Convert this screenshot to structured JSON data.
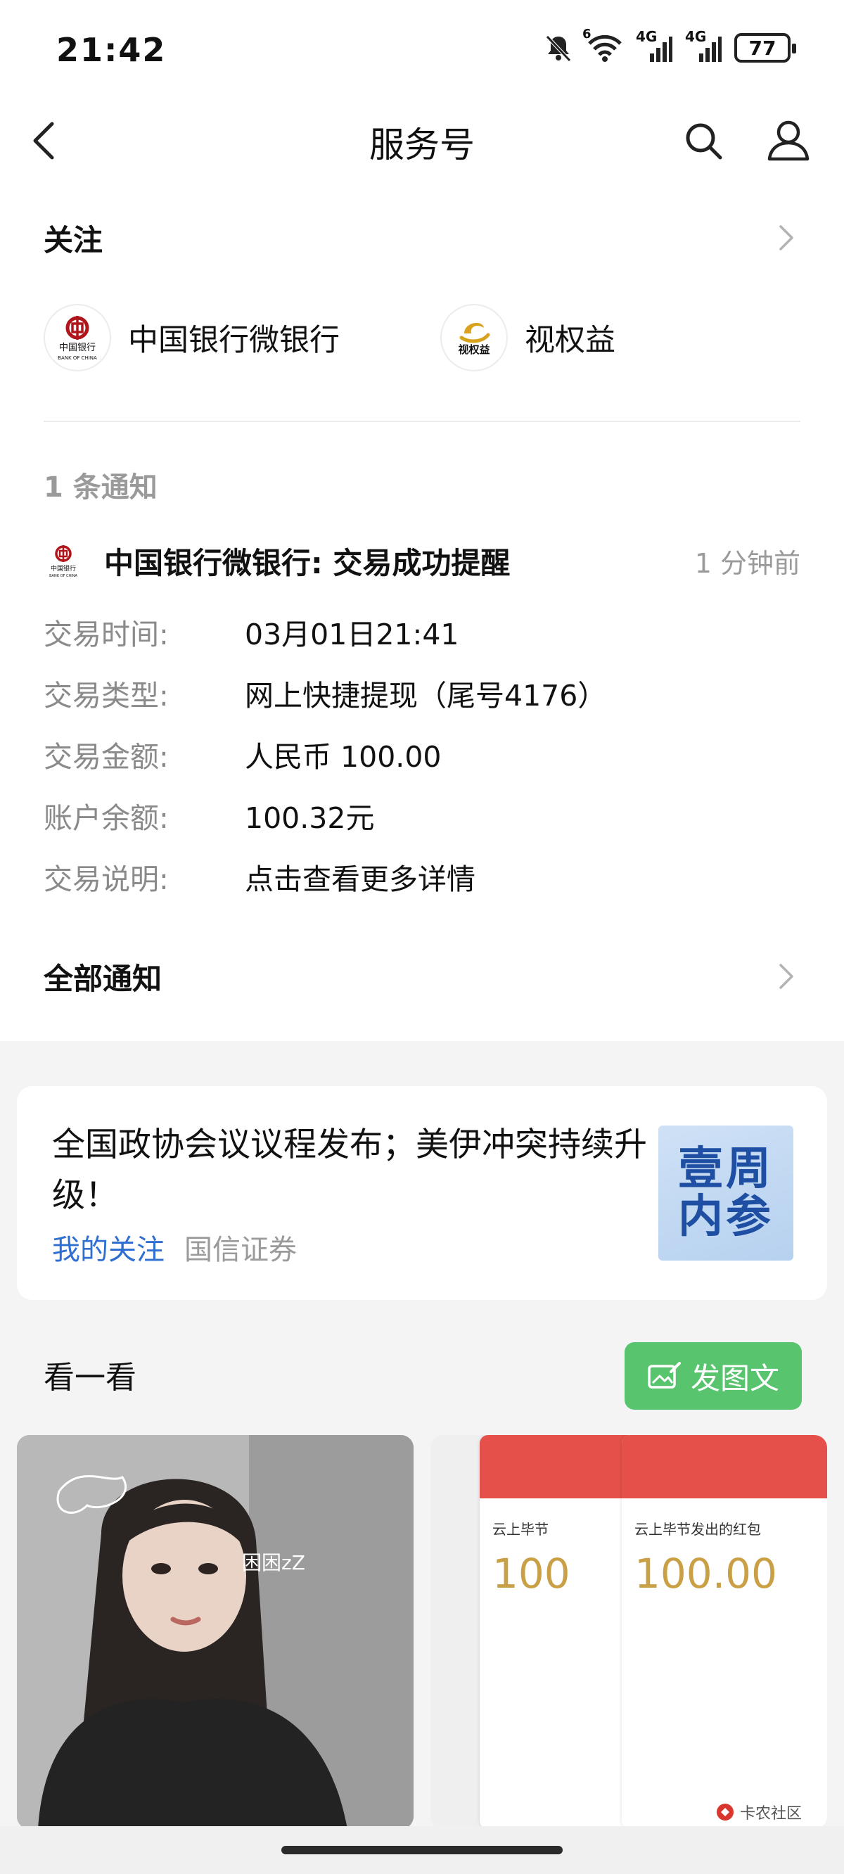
{
  "status_bar": {
    "time": "21:42",
    "icons": [
      "bell-off-icon",
      "wifi-icon",
      "signal-4g-icon",
      "signal-4g-icon"
    ],
    "wifi_label": "6",
    "signal1_label": "4G",
    "signal2_label": "4G",
    "battery": "77"
  },
  "nav": {
    "title": "服务号"
  },
  "follow": {
    "title": "关注",
    "accounts": [
      {
        "name": "中国银行微银行",
        "logo_text": "BANK OF CHINA"
      },
      {
        "name": "视权益",
        "logo_text": "视权益"
      }
    ]
  },
  "notifications": {
    "count_label": "1 条通知",
    "item": {
      "title": "中国银行微银行: 交易成功提醒",
      "time": "1 分钟前",
      "rows": [
        {
          "label": "交易时间:",
          "value": "03月01日21:41"
        },
        {
          "label": "交易类型:",
          "value": "网上快捷提现（尾号4176）"
        },
        {
          "label": "交易金额:",
          "value": "人民币 100.00"
        },
        {
          "label": "账户余额:",
          "value": "100.32元"
        },
        {
          "label": "交易说明:",
          "value": "点击查看更多详情"
        }
      ]
    },
    "all_label": "全部通知"
  },
  "news": {
    "title": "全国政协会议议程发布；美伊冲突持续升级！",
    "tag": "我的关注",
    "source": "国信证券",
    "thumb_line1": "壹周",
    "thumb_line2": "内参"
  },
  "look": {
    "title": "看一看",
    "post_button": "发图文",
    "tiles": [
      {
        "type": "photo",
        "overlay_text": "困困zZ"
      },
      {
        "type": "screenshot",
        "card1": {
          "sender": "云上毕节",
          "amount": "100"
        },
        "card2": {
          "sender": "云上毕节发出的红包",
          "amount": "100.00"
        }
      }
    ]
  },
  "watermark": {
    "text": "卡农社区"
  },
  "colors": {
    "accent_green": "#58c46e",
    "link_blue": "#2f6fd1",
    "muted_gray": "#9a9a9a",
    "bank_red": "#b0151c"
  }
}
